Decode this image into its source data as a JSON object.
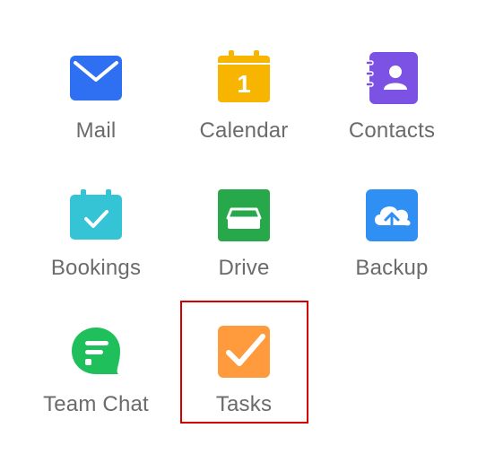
{
  "apps": [
    {
      "label": "Mail",
      "icon": "mail-icon",
      "color": "#2f6ff2"
    },
    {
      "label": "Calendar",
      "icon": "calendar-icon",
      "color": "#f7b500",
      "badge": "1"
    },
    {
      "label": "Contacts",
      "icon": "contacts-icon",
      "color": "#7b52e4"
    },
    {
      "label": "Bookings",
      "icon": "bookings-icon",
      "color": "#35c3d6"
    },
    {
      "label": "Drive",
      "icon": "drive-icon",
      "color": "#27a84a"
    },
    {
      "label": "Backup",
      "icon": "backup-icon",
      "color": "#2f8ff2"
    },
    {
      "label": "Team Chat",
      "icon": "team-chat-icon",
      "color": "#1fbf5c"
    },
    {
      "label": "Tasks",
      "icon": "tasks-icon",
      "color": "#ff9a3d"
    }
  ],
  "highlight_color": "#d40000"
}
